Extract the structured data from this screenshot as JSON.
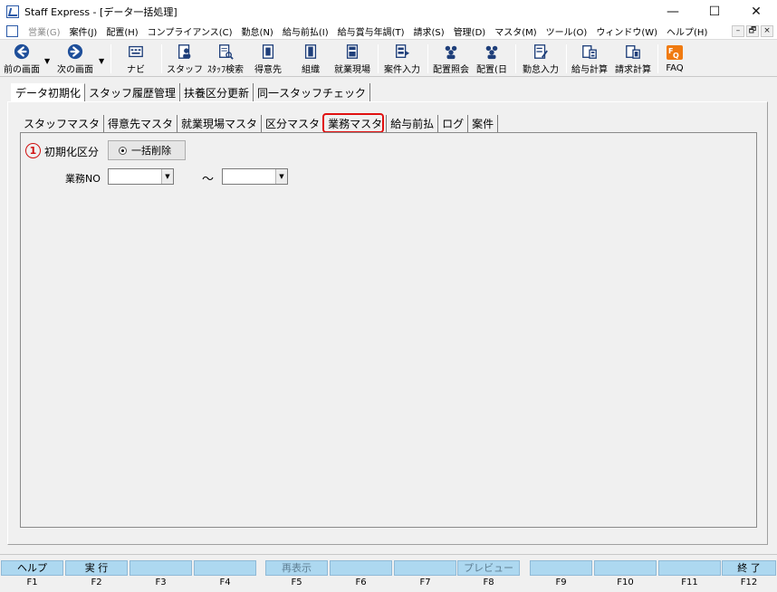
{
  "window": {
    "title": "Staff Express - [データ一括処理]",
    "controls": {
      "minimize": "—",
      "maximize": "☐",
      "close": "✕"
    }
  },
  "menu": {
    "items": [
      {
        "label": "営業(G)",
        "disabled": true
      },
      {
        "label": "案件(J)"
      },
      {
        "label": "配置(H)"
      },
      {
        "label": "コンプライアンス(C)"
      },
      {
        "label": "勤怠(N)"
      },
      {
        "label": "給与前払(I)"
      },
      {
        "label": "給与賞与年調(T)"
      },
      {
        "label": "請求(S)"
      },
      {
        "label": "管理(D)"
      },
      {
        "label": "マスタ(M)"
      },
      {
        "label": "ツール(O)"
      },
      {
        "label": "ウィンドウ(W)"
      },
      {
        "label": "ヘルプ(H)"
      }
    ],
    "mdi": {
      "minimize": "–",
      "restore": "🗗",
      "close": "×"
    }
  },
  "toolbar": {
    "prev": "前の画面",
    "next": "次の画面",
    "navi": "ナビ",
    "staff": "スタッフ",
    "staff_search": "ｽﾀｯﾌ検索",
    "client": "得意先",
    "org": "組織",
    "worksite": "就業現場",
    "case_entry": "案件入力",
    "placement_query": "配置照会",
    "placement_day": "配置(日",
    "attendance_entry": "勤怠入力",
    "payroll_calc": "給与計算",
    "billing_calc": "請求計算",
    "faq": "FAQ"
  },
  "top_tabs": [
    "データ初期化",
    "スタッフ履歴管理",
    "扶養区分更新",
    "同一スタッフチェック"
  ],
  "sub_tabs": [
    "スタッフマスタ",
    "得意先マスタ",
    "就業現場マスタ",
    "区分マスタ",
    "業務マスタ",
    "給与前払",
    "ログ",
    "案件"
  ],
  "form": {
    "circle_num": "1",
    "init_label": "初期化区分",
    "radio_label": "一括削除",
    "gyomu_label": "業務NO",
    "from_value": "",
    "to_value": "",
    "tilde": "～"
  },
  "fkeys": [
    {
      "label": "ヘルプ",
      "key": "F1"
    },
    {
      "label": "実 行",
      "key": "F2"
    },
    {
      "label": "",
      "key": "F3"
    },
    {
      "label": "",
      "key": "F4"
    },
    {
      "label": "再表示",
      "key": "F5",
      "disabled": true
    },
    {
      "label": "",
      "key": "F6"
    },
    {
      "label": "",
      "key": "F7"
    },
    {
      "label": "プレビュー",
      "key": "F8",
      "disabled": true
    },
    {
      "label": "",
      "key": "F9"
    },
    {
      "label": "",
      "key": "F10"
    },
    {
      "label": "",
      "key": "F11"
    },
    {
      "label": "終 了",
      "key": "F12"
    }
  ],
  "colors": {
    "highlight_red": "#e01010",
    "fkey_blue": "#add8f0",
    "nav_blue": "#1f4f9a"
  }
}
